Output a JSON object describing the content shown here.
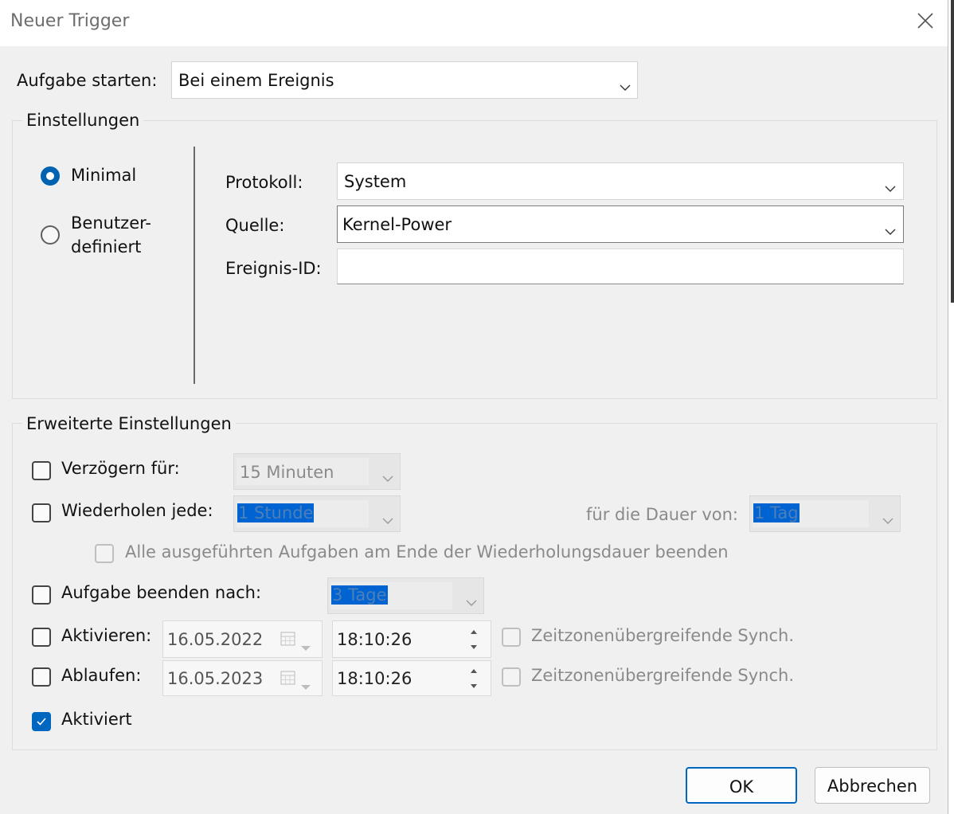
{
  "window": {
    "title": "Neuer Trigger"
  },
  "start_task": {
    "label": "Aufgabe starten:",
    "value": "Bei einem Ereignis"
  },
  "settings": {
    "group_title": "Einstellungen",
    "radio_minimal": "Minimal",
    "radio_custom_line1": "Benutzer-",
    "radio_custom_line2": "definiert",
    "selected": "Minimal",
    "protocol_label": "Protokoll:",
    "protocol_value": "System",
    "source_label": "Quelle:",
    "source_value": "Kernel-Power",
    "event_id_label": "Ereignis-ID:",
    "event_id_value": ""
  },
  "advanced": {
    "group_title": "Erweiterte Einstellungen",
    "delay_label": "Verzögern für:",
    "delay_value": "15 Minuten",
    "delay_checked": false,
    "repeat_label": "Wiederholen jede:",
    "repeat_value": "1 Stunde",
    "repeat_checked": false,
    "duration_label": "für die Dauer von:",
    "duration_value": "1 Tag",
    "stop_all_label": "Alle ausgeführten Aufgaben am Ende der Wiederholungsdauer beenden",
    "stop_all_checked": false,
    "end_task_label": "Aufgabe beenden nach:",
    "end_task_value": "3 Tage",
    "end_task_checked": false,
    "activate_label": "Aktivieren:",
    "activate_date": "16.05.2022",
    "activate_time": "18:10:26",
    "activate_checked": false,
    "activate_sync_label": "Zeitzonenübergreifende Synch.",
    "expire_label": "Ablaufen:",
    "expire_date": "16.05.2023",
    "expire_time": "18:10:26",
    "expire_checked": false,
    "expire_sync_label": "Zeitzonenübergreifende Synch.",
    "enabled_label": "Aktiviert",
    "enabled_checked": true
  },
  "buttons": {
    "ok": "OK",
    "cancel": "Abbrechen"
  },
  "icons": {
    "close": "close-icon",
    "dropdown": "chevron-down-icon",
    "calendar": "calendar-icon",
    "spin_up": "spin-up-icon",
    "spin_down": "spin-down-icon",
    "check": "check-icon"
  },
  "colors": {
    "accent": "#0067c0",
    "selection": "#0063d2",
    "background": "#f0f0f0"
  }
}
